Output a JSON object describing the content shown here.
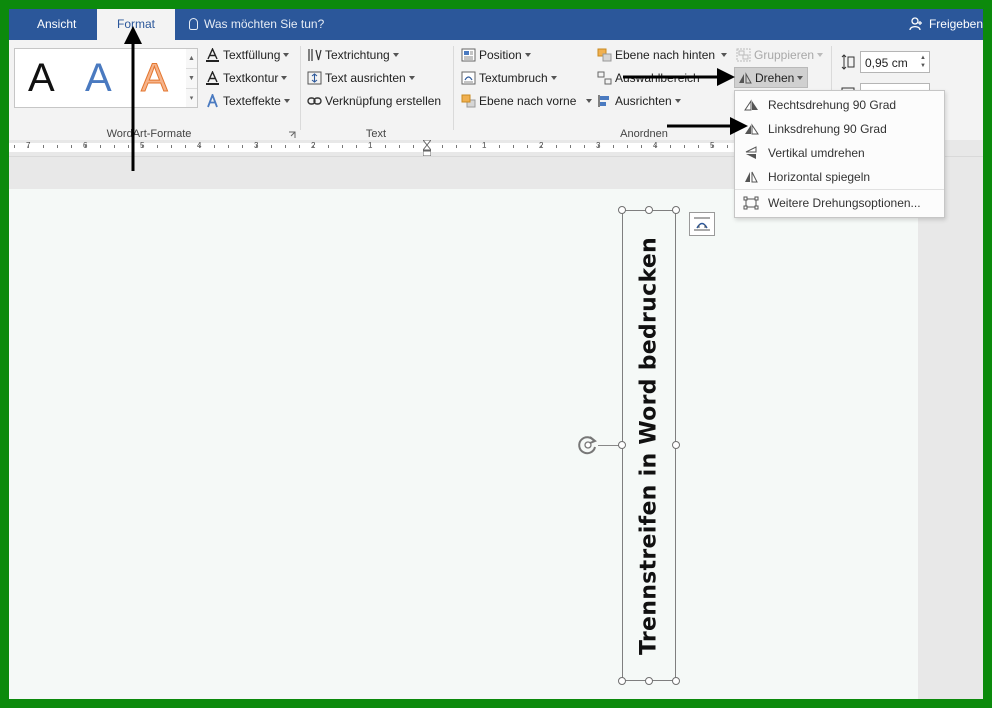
{
  "tabs": {
    "ansicht": "Ansicht",
    "format": "Format"
  },
  "tell_me": "Was möchten Sie tun?",
  "share": "Freigeben",
  "wordart": {
    "letters": [
      "A",
      "A",
      "A"
    ],
    "textfill": "Textfüllung",
    "textoutline": "Textkontur",
    "texteffects": "Texteffekte",
    "group_label": "WordArt-Formate"
  },
  "text_group": {
    "direction": "Textrichtung",
    "align": "Text ausrichten",
    "link": "Verknüpfung erstellen",
    "group_label": "Text"
  },
  "arrange": {
    "position": "Position",
    "wrap": "Textumbruch",
    "bring_forward": "Ebene nach vorne",
    "send_backward": "Ebene nach hinten",
    "selection_pane": "Auswahlbereich",
    "align": "Ausrichten",
    "group": "Gruppieren",
    "rotate": "Drehen",
    "group_label": "Anordnen"
  },
  "size": {
    "height": "0,95 cm"
  },
  "rotate_menu": [
    {
      "label": "Rechtsdrehung 90 Grad",
      "icon": "rotate-right-icon"
    },
    {
      "label": "Linksdrehung 90 Grad",
      "icon": "rotate-left-icon"
    },
    {
      "label": "Vertikal umdrehen",
      "icon": "flip-vertical-icon"
    },
    {
      "label": "Horizontal spiegeln",
      "icon": "flip-horizontal-icon"
    },
    {
      "label": "Weitere Drehungsoptionen...",
      "icon": "more-rotation-icon"
    }
  ],
  "ruler_numbers": [
    "7",
    "6",
    "5",
    "4",
    "3",
    "2",
    "1",
    "1",
    "2",
    "3",
    "4",
    "5"
  ],
  "textbox_text": "Trennstreifen in Word bedrucken",
  "colors": {
    "title_bar": "#2b579a",
    "border": "#0c8a0c",
    "ribbon": "#f3f3f3"
  }
}
